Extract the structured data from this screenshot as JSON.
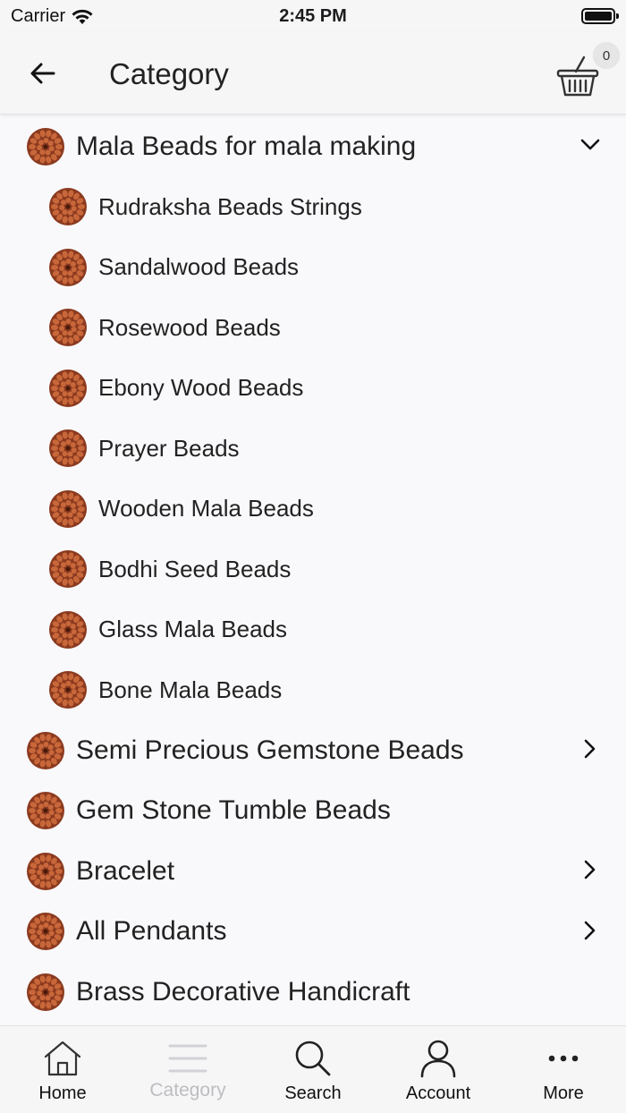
{
  "status": {
    "carrier": "Carrier",
    "time": "2:45 PM"
  },
  "header": {
    "title": "Category",
    "cart_count": "0"
  },
  "categories": [
    {
      "label": "Mala Beads for mala making",
      "level": 0,
      "chevron": "down"
    },
    {
      "label": "Rudraksha Beads Strings",
      "level": 1,
      "chevron": ""
    },
    {
      "label": "Sandalwood Beads",
      "level": 1,
      "chevron": ""
    },
    {
      "label": "Rosewood Beads",
      "level": 1,
      "chevron": ""
    },
    {
      "label": "Ebony Wood Beads",
      "level": 1,
      "chevron": ""
    },
    {
      "label": "Prayer Beads",
      "level": 1,
      "chevron": ""
    },
    {
      "label": "Wooden Mala Beads",
      "level": 1,
      "chevron": ""
    },
    {
      "label": "Bodhi Seed Beads",
      "level": 1,
      "chevron": ""
    },
    {
      "label": "Glass Mala Beads",
      "level": 1,
      "chevron": ""
    },
    {
      "label": "Bone Mala Beads",
      "level": 1,
      "chevron": ""
    },
    {
      "label": "Semi Precious Gemstone Beads",
      "level": 0,
      "chevron": "right"
    },
    {
      "label": "Gem Stone Tumble Beads",
      "level": 0,
      "chevron": ""
    },
    {
      "label": "Bracelet",
      "level": 0,
      "chevron": "right"
    },
    {
      "label": "All Pendants",
      "level": 0,
      "chevron": "right"
    },
    {
      "label": "Brass Decorative Handicraft",
      "level": 0,
      "chevron": ""
    }
  ],
  "tabs": [
    {
      "label": "Home",
      "icon": "home-icon",
      "active": false
    },
    {
      "label": "Category",
      "icon": "menu-icon",
      "active": true
    },
    {
      "label": "Search",
      "icon": "search-icon",
      "active": false
    },
    {
      "label": "Account",
      "icon": "user-icon",
      "active": false
    },
    {
      "label": "More",
      "icon": "more-icon",
      "active": false
    }
  ],
  "colors": {
    "bead": "#8b3a1f",
    "bead_highlight": "#c8673a",
    "inactive_tab": "#bdbdc2",
    "text": "#222222"
  }
}
